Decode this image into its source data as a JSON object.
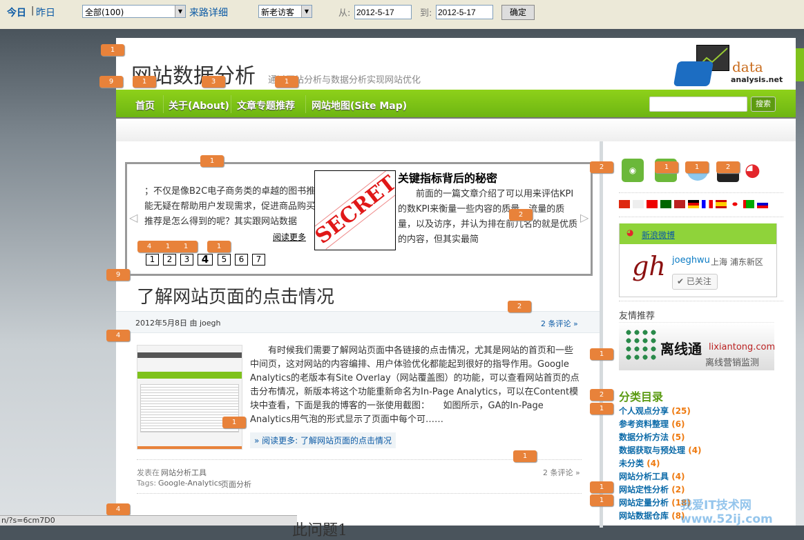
{
  "toolbar": {
    "today": "今日",
    "sep": "|",
    "yesterday": "昨日",
    "source_select": "全部(100)",
    "source_detail": "来路详细",
    "visitor_select": "新老访客",
    "from_label": "从:",
    "from_value": "2012-5-17",
    "to_label": "到:",
    "to_value": "2012-5-17",
    "confirm": "确定"
  },
  "header": {
    "title": "网站数据分析",
    "tagline": "通过网站分析与数据分析实现网站优化",
    "logo_top": "data",
    "logo_bottom": "analysis.net"
  },
  "nav": {
    "items": [
      "首页",
      "关于(About)",
      "文章专题推荐",
      "网站地图(Site Map)"
    ],
    "search_button": "搜索"
  },
  "slider": {
    "left_lines": [
      "；不仅是像B2C电子商务类的卓越的图书推",
      "能无疑在帮助用户发现需求，促进商品购买",
      "推荐是怎么得到的呢？其实跟网站数据"
    ],
    "left_readmore": "阅读更多",
    "image_text": "SECRET",
    "title": "关键指标背后的秘密",
    "right_text": "前面的一篇文章介绍了可以用来评估KPI的数KPI来衡量一些内容的质量、流量的质量，以及访序，并认为排在前几名的就是优质的内容，但其实最简",
    "pages": [
      "1",
      "2",
      "3",
      "4",
      "5",
      "6",
      "7"
    ],
    "current_page": "4"
  },
  "post": {
    "title": "了解网站页面的点击情况",
    "date": "2012年5月8日 由 joegh",
    "comments": "2 条评论 »",
    "body": "有时候我们需要了解网站页面中各链接的点击情况，尤其是网站的首页和一些中间页，这对网站的内容编排、用户体验优化都能起到很好的指导作用。Google Analytics的老版本有Site Overlay（网站覆盖图）的功能，可以查看网站首页的点击分布情况，新版本将这个功能重新命名为In-Page Analytics，可以在Content模块中查看，下面是我的博客的一张使用截图：　　如图所示，GA的In-Page Analytics用气泡的形式显示了页面中每个可……",
    "readmore": "» 阅读更多: 了解网站页面的点击情况",
    "posted_in_label": "发表在",
    "category": "网站分析工具",
    "tags_label": "Tags:",
    "tags": [
      "Google-Analytics",
      "页面分析"
    ],
    "footer_comments": "2 条评论 »",
    "next_title_partial": "此问题1"
  },
  "sidebar": {
    "weibo_title": "新浪微博",
    "weibo_user": "joeghwu",
    "weibo_location": "上海 浦东新区",
    "follow": "已关注",
    "friends_title": "友情推荐",
    "ad_name": "离线通",
    "ad_domain": "lixiantong.com",
    "ad_slogan": "离线营销监测",
    "categories_title": "分类目录",
    "categories": [
      {
        "name": "个人观点分享",
        "count": "(25)"
      },
      {
        "name": "参考资料整理",
        "count": "(6)"
      },
      {
        "name": "数据分析方法",
        "count": "(5)"
      },
      {
        "name": "数据获取与预处理",
        "count": "(4)"
      },
      {
        "name": "未分类",
        "count": "(4)"
      },
      {
        "name": "网站分析工具",
        "count": "(4)"
      },
      {
        "name": "网站定性分析",
        "count": "(2)"
      },
      {
        "name": "网站定量分析",
        "count": "(18)"
      },
      {
        "name": "网站数据仓库",
        "count": "(8)"
      }
    ]
  },
  "badges": [
    "1",
    "9",
    "1",
    "3",
    "1",
    "1",
    "2",
    "1",
    "1",
    "2",
    "2",
    "4",
    "1",
    "1",
    "1",
    "9",
    "2",
    "4",
    "1",
    "1",
    "1",
    "2",
    "1",
    "1",
    "1",
    "4"
  ],
  "status_bar": "n/?s=6cm7D0",
  "watermark": "我爱IT技术网 www.52ij.com"
}
